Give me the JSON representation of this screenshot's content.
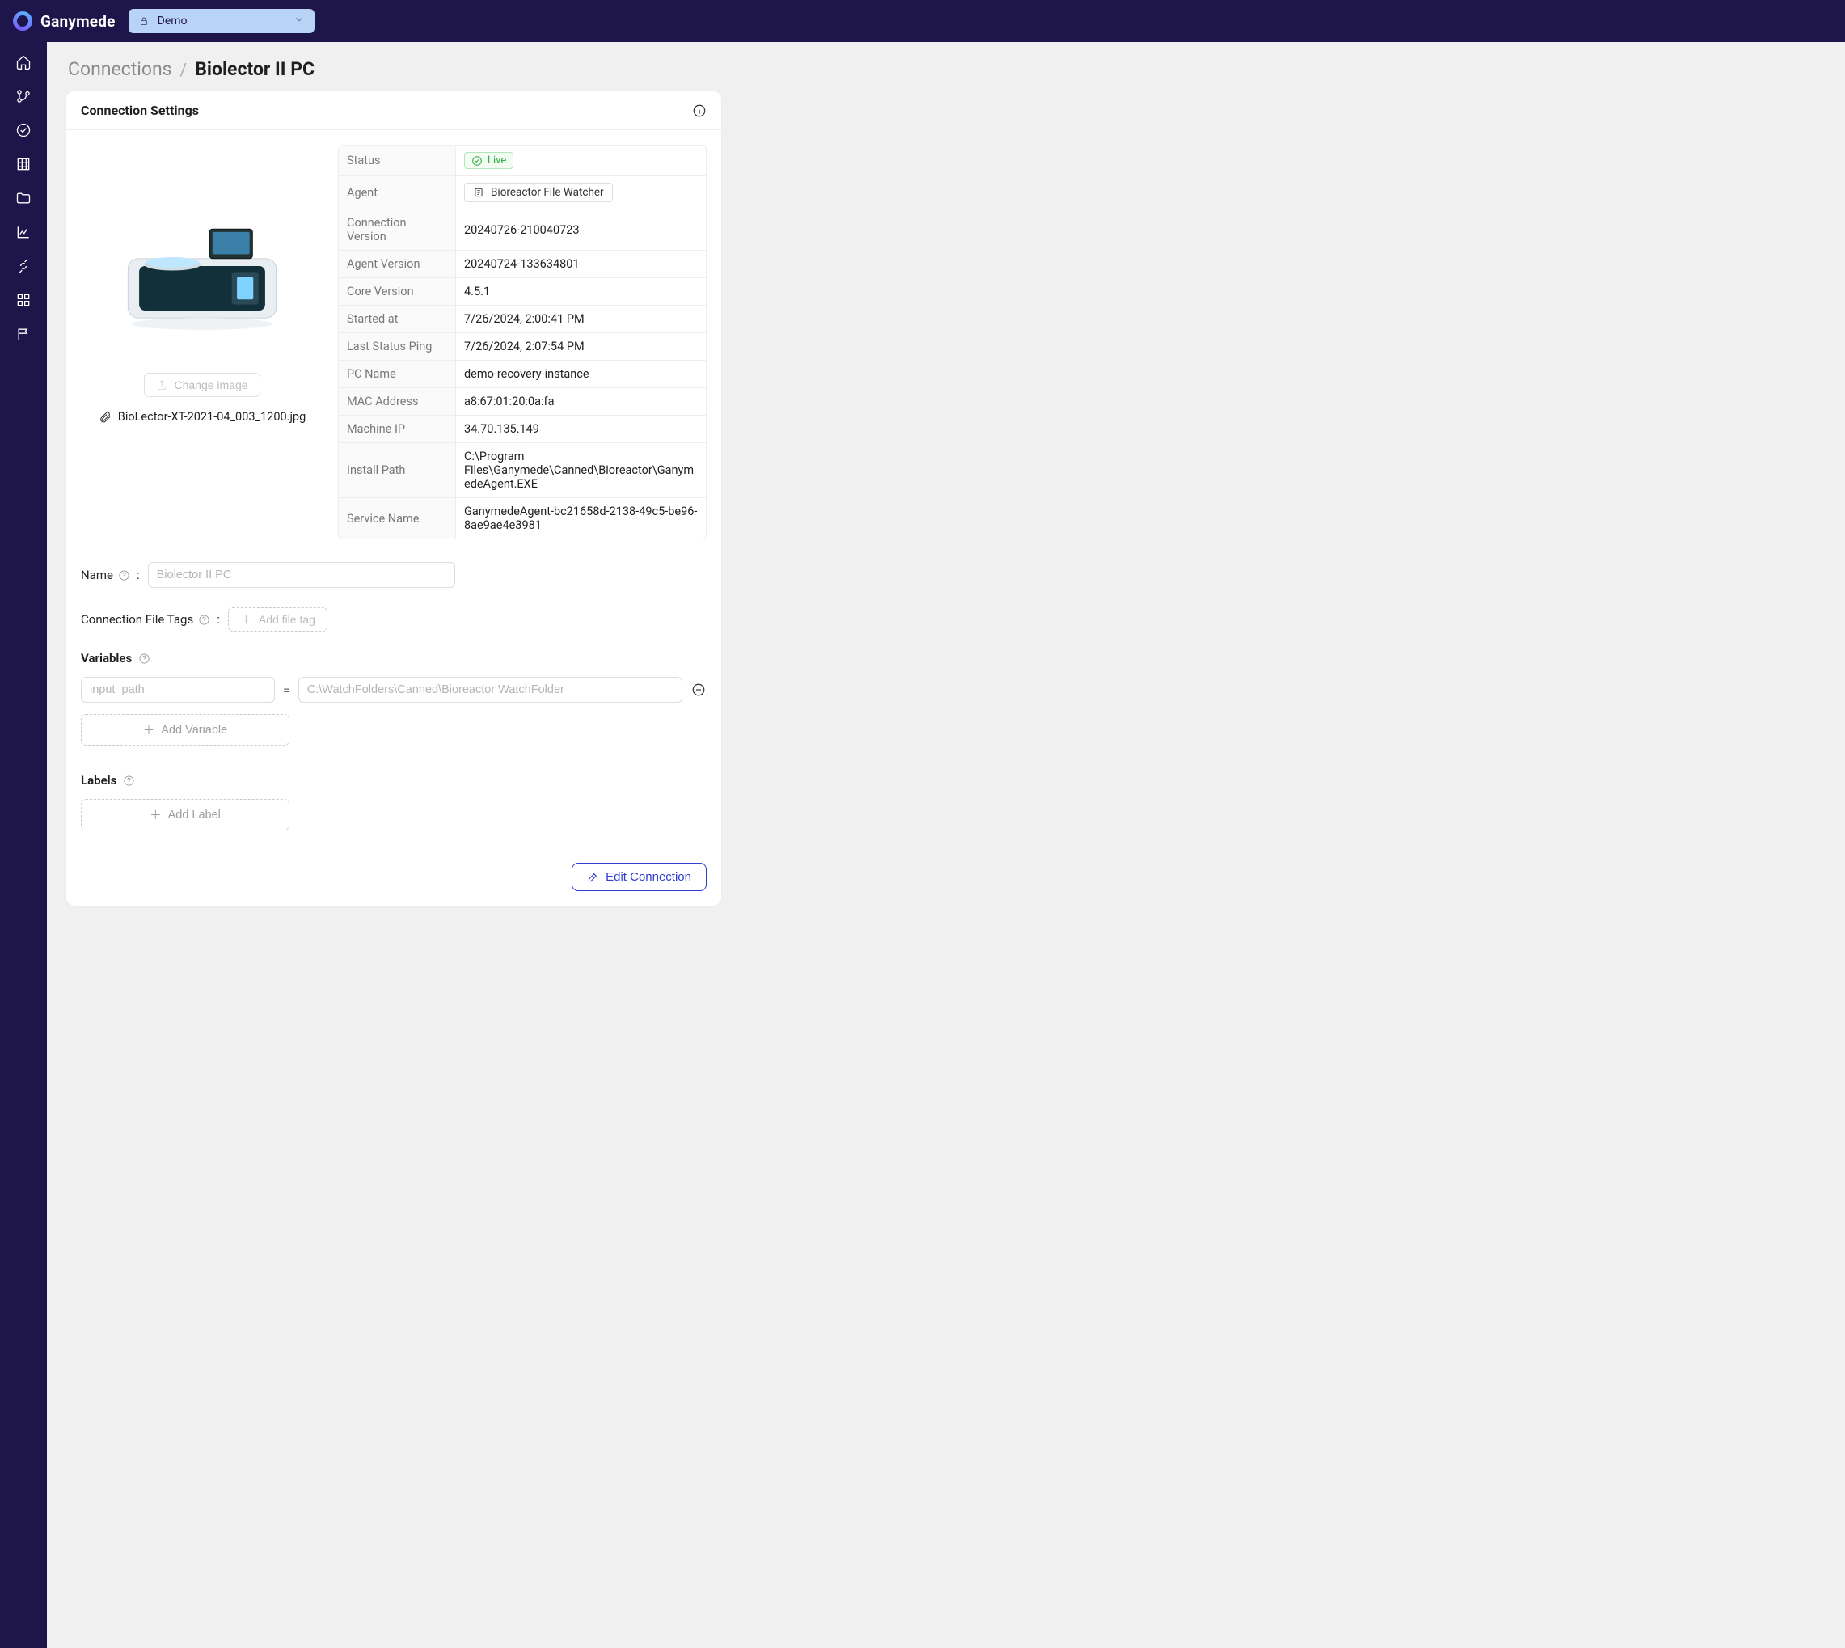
{
  "brand": "Ganymede",
  "env_selector": {
    "value": "Demo"
  },
  "breadcrumb": {
    "parent": "Connections",
    "current": "Biolector II PC"
  },
  "card": {
    "title": "Connection Settings",
    "change_image": "Change image",
    "filename": "BioLector-XT-2021-04_003_1200.jpg",
    "details": {
      "status_label": "Status",
      "status_value": "Live",
      "agent_label": "Agent",
      "agent_value": "Bioreactor File Watcher",
      "conn_version_label": "Connection Version",
      "conn_version_value": "20240726-210040723",
      "agent_version_label": "Agent Version",
      "agent_version_value": "20240724-133634801",
      "core_version_label": "Core Version",
      "core_version_value": "4.5.1",
      "started_label": "Started at",
      "started_value": "7/26/2024, 2:00:41 PM",
      "ping_label": "Last Status Ping",
      "ping_value": "7/26/2024, 2:07:54 PM",
      "pc_label": "PC Name",
      "pc_value": "demo-recovery-instance",
      "mac_label": "MAC Address",
      "mac_value": "a8:67:01:20:0a:fa",
      "ip_label": "Machine IP",
      "ip_value": "34.70.135.149",
      "install_label": "Install Path",
      "install_value": "C:\\Program Files\\Ganymede\\Canned\\Bioreactor\\GanymedeAgent.EXE",
      "service_label": "Service Name",
      "service_value": "GanymedeAgent-bc21658d-2138-49c5-be96-8ae9ae4e3981"
    }
  },
  "form": {
    "name_label": "Name",
    "name_placeholder": "Biolector II PC",
    "tags_label": "Connection File Tags",
    "add_tag_label": "Add file tag",
    "variables_title": "Variables",
    "var_key_placeholder": "input_path",
    "var_val_placeholder": "C:\\WatchFolders\\Canned\\Bioreactor WatchFolder",
    "add_variable_label": "Add Variable",
    "labels_title": "Labels",
    "add_label_label": "Add Label",
    "edit_button": "Edit Connection",
    "equals": "="
  }
}
